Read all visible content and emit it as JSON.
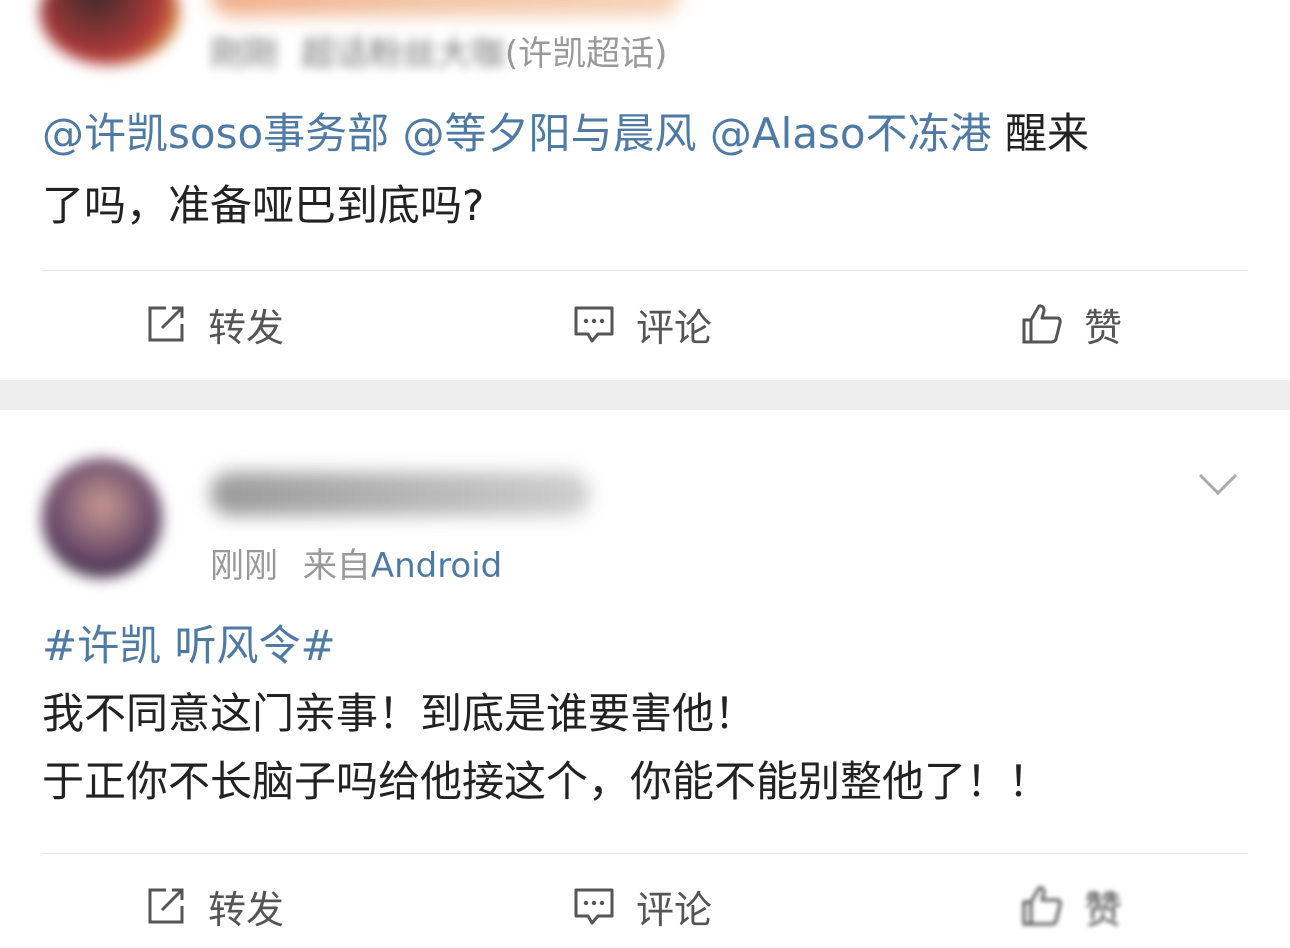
{
  "posts": [
    {
      "time": "刚刚",
      "badge": "超话粉丝大咖",
      "topic_ref": "(许凯超话)",
      "mentions": [
        "@许凯soso事务部",
        "@等夕阳与晨风",
        "@Alaso不冻港"
      ],
      "text_after_mentions": "醒来",
      "text_line2": "了吗，准备哑巴到底吗?",
      "actions": {
        "repost": "转发",
        "comment": "评论",
        "like": "赞"
      }
    },
    {
      "time": "刚刚",
      "source_prefix": "来自",
      "source": "Android",
      "topic": "#许凯 听风令#",
      "line1": "我不同意这门亲事！到底是谁要害他！",
      "line2": "于正你不长脑子吗给他接这个，你能不能别整他了！！",
      "actions": {
        "repost": "转发",
        "comment": "评论",
        "like": "赞"
      }
    }
  ],
  "icons": {
    "repost": "repost-icon",
    "comment": "comment-icon",
    "like": "thumbs-up-icon",
    "more": "chevron-down-icon"
  },
  "colors": {
    "link": "#4f7aa3",
    "text": "#222222",
    "meta": "#999999",
    "separator": "#eeeeee"
  }
}
